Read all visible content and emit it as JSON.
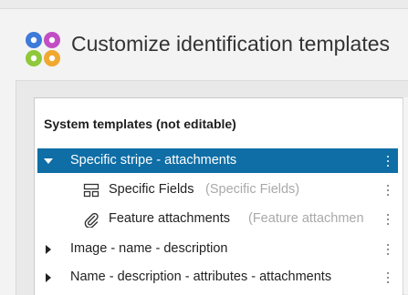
{
  "window": {
    "title": "Customize identification templates"
  },
  "tree": {
    "section_label": "System templates (not editable)",
    "rows": [
      {
        "label": "Specific stripe - attachments",
        "desc": "",
        "expanded": true,
        "selected": true,
        "icon": "caret-down-icon"
      },
      {
        "label": "Specific Fields",
        "desc": "(Specific Fields)",
        "child": true,
        "icon": "fields-icon"
      },
      {
        "label": "Feature attachments",
        "desc": "(Feature attachmen",
        "child": true,
        "icon": "paperclip-icon"
      },
      {
        "label": "Image - name - description",
        "desc": "",
        "expanded": false,
        "icon": "caret-right-icon"
      },
      {
        "label": "Name - description - attributes - attachments",
        "desc": "",
        "expanded": false,
        "icon": "caret-right-icon"
      }
    ]
  },
  "colors": {
    "selection": "#0f6ea6",
    "logo": [
      "#3d7ad9",
      "#c14fc4",
      "#8fc83a",
      "#f0a830"
    ]
  }
}
